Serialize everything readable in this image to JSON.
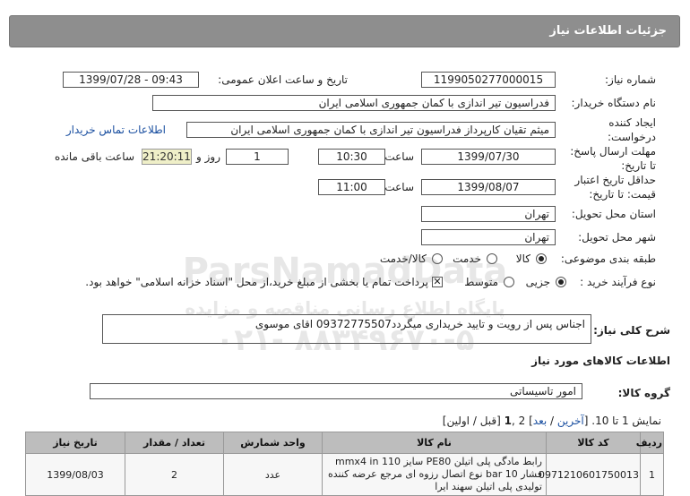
{
  "page": {
    "title": "جزئیات اطلاعات نیاز"
  },
  "fields": {
    "need_number_label": "شماره نیاز:",
    "need_number": "1199050277000015",
    "announce_label": "تاریخ و ساعت اعلان عمومی:",
    "announce_value": "1399/07/28 - 09:43",
    "buyer_org_label": "نام دستگاه خریدار:",
    "buyer_org": "فدراسیون تیر اندازی با کمان جمهوری اسلامی ایران",
    "creator_label_1": "ایجاد کننده",
    "creator_label_2": "درخواست:",
    "creator": "میثم تقیان کارپرداز فدراسیون تیر اندازی با کمان جمهوری اسلامی ایران",
    "contact_link": "اطلاعات تماس خریدار",
    "deadline_label_1": "مهلت ارسال پاسخ:",
    "deadline_label_2": "تا تاریخ:",
    "deadline_date": "1399/07/30",
    "time_word": "ساعت",
    "deadline_time": "10:30",
    "days_value": "1",
    "days_label": "روز و",
    "remaining_timer": "21:20:11",
    "remaining_label": "ساعت باقی مانده",
    "validity_label_1": "حداقل تاریخ اعتبار",
    "validity_label_2": "قیمت: تا تاریخ:",
    "validity_date": "1399/08/07",
    "validity_time": "11:00",
    "province_label": "استان محل تحویل:",
    "province": "تهران",
    "city_label": "شهر محل تحویل:",
    "city": "تهران",
    "category_label": "طبقه بندی موضوعی:",
    "category_options": [
      "کالا",
      "خدمت",
      "کالا/خدمت"
    ],
    "process_label": "نوع فرآیند خرید :",
    "process_options": [
      "جزیی",
      "متوسط"
    ],
    "payment_note": "پرداخت تمام یا بخشی از مبلغ خرید،از محل \"اسناد خزانه اسلامی\" خواهد بود."
  },
  "description": {
    "label": "شرح کلی نیاز:",
    "text": "اجناس پس از رویت و تایید خریداری میگردد09372775507 اقای موسوی"
  },
  "goods": {
    "section_title": "اطلاعات کالاهای مورد نیاز",
    "group_label": "گروه کالا:",
    "group_value": "امور تاسیساتی"
  },
  "watermark": {
    "line1": "ParsNamadData",
    "line2": "پایگاه اطلاع رسانی مناقصه و مزایده",
    "line3": "۰۲۱- ۸۸۳۴۹۶۷۰-۵"
  },
  "paging": {
    "prefix": "نمایش 1 تا 10. [",
    "last": "آخرین",
    "sep1": " / ",
    "next": "بعد",
    "mid": "] 2 ,",
    "current": "1",
    "suffix": " [قبل / اولین]"
  },
  "table": {
    "headers": [
      "ردیف",
      "کد کالا",
      "نام کالا",
      "واحد شمارش",
      "تعداد / مقدار",
      "تاریخ نیاز"
    ],
    "rows": [
      {
        "row": "1",
        "code": "0971210601750013",
        "name": "رابط مادگی پلی اتیلن PE80 سایز 110 mmx4 in فشار 10 bar نوع اتصال رزوه ای مرجع عرضه کننده تولیدی پلی اتیلن سهند ایرا",
        "unit": "عدد",
        "qty": "2",
        "date": "1399/08/03"
      }
    ]
  }
}
